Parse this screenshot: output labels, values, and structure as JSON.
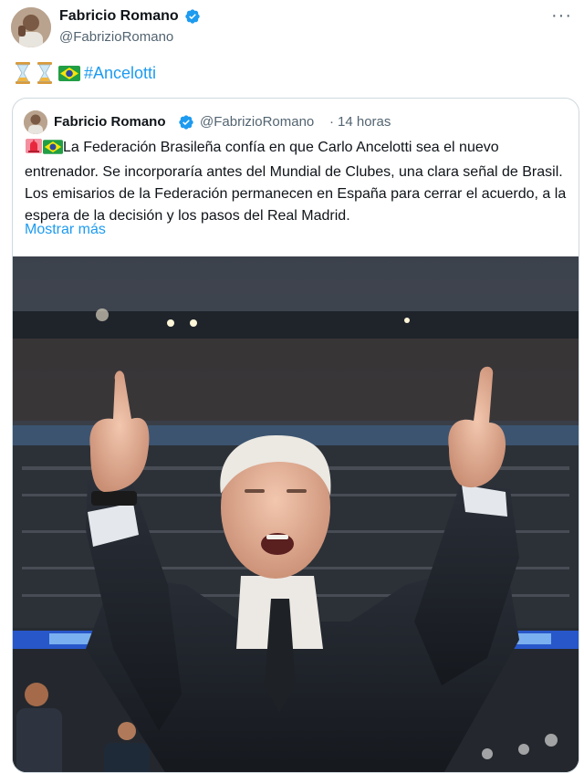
{
  "tweet": {
    "author_name": "Fabricio Romano",
    "author_handle": "@FabrizioRomano",
    "emojis": [
      "hourglass",
      "hourglass",
      "brazil-flag"
    ],
    "hashtag": "#Ancelotti",
    "more_label": "···"
  },
  "quoted": {
    "author_name": "Fabricio Romano",
    "author_handle": "@FabrizioRomano",
    "separator": "·",
    "time": "14 horas",
    "text": "La Federación Brasileña confía en que Carlo Ancelotti sea el nuevo entrenador. Se incorporaría antes del Mundial de Clubes, una clara señal de Brasil. Los emisarios de la Federación permanecen en España para cerrar el acuerdo, a la espera de la decisión y los pasos del Real Madrid.",
    "show_more": "Mostrar más",
    "leading_emojis": [
      "siren",
      "brazil-flag"
    ]
  },
  "colors": {
    "verified": "#1d9bf0",
    "link": "#1d9bf0",
    "secondary_text": "#536471",
    "border": "#cfd9de"
  }
}
